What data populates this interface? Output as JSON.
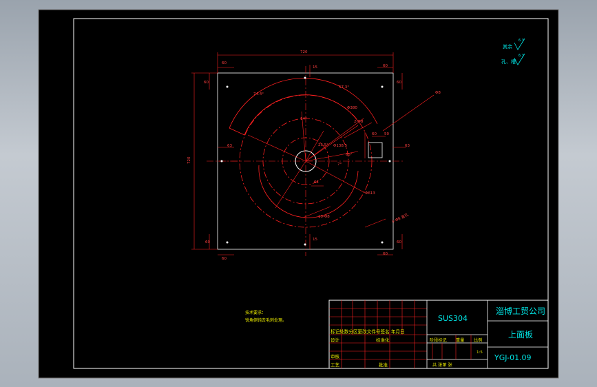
{
  "colors": {
    "background": "#000000",
    "frame": "#ffffff",
    "geometry": "#ff2020",
    "annotation": "#00e5e5",
    "text": "#00e0e0",
    "text_yellow": "#e8e800"
  },
  "drawing": {
    "dimensions": {
      "plate_width": "720",
      "plate_height": "720",
      "edge_left_top": "60",
      "edge_left_bottom": "60",
      "edge_right_top": "60",
      "edge_right_bottom": "60",
      "side_top_left": "60",
      "side_bottom_left": "60",
      "side_top_right": "60",
      "side_bottom_right": "60",
      "center_mark_top": "15",
      "center_mark_bottom": "15",
      "left_offset": "63",
      "slot_left": "63",
      "slot_width": "60",
      "slot_height": "50",
      "slot_offset": "63",
      "angle_74": "74.4°",
      "angle_57": "57.3°",
      "angle_14": "14°",
      "angle_25": "25.5°",
      "angle_7": "7°",
      "angle_65": "65°",
      "dia_380": "Φ380",
      "dia_138": "Φ138.5",
      "dia_613": "Φ613",
      "dia_48": "Φ48",
      "holes_2": "2-Φ8",
      "holes_10": "10-Φ8",
      "holes_4": "4-Φ8 盲孔",
      "r_61": "61",
      "dia_8": "Φ8",
      "angle_7b": "7°",
      "slot_label": "15"
    },
    "surface_roughness": {
      "label_1": "其余",
      "value_1": "6.3",
      "label_2": "孔、槽",
      "value_2": "6.3"
    },
    "notes": {
      "title": "技术要求：",
      "line_1": "锐角倒钝去毛刺处理。"
    }
  },
  "title_block": {
    "material": "SUS304",
    "company": "淄博工贸公司",
    "part_name": "上面板",
    "drawing_no": "YGJ-01.09",
    "header_row": "标记处数分区更改文件号签名 年月日",
    "design": "设计",
    "standardize": "标准化",
    "review": "审核",
    "process": "工艺",
    "approve": "批准",
    "stage_mark": "阶段标记",
    "weight": "重量",
    "scale": "比例",
    "scale_value": "1:5",
    "sheets": "共  张第  张"
  }
}
